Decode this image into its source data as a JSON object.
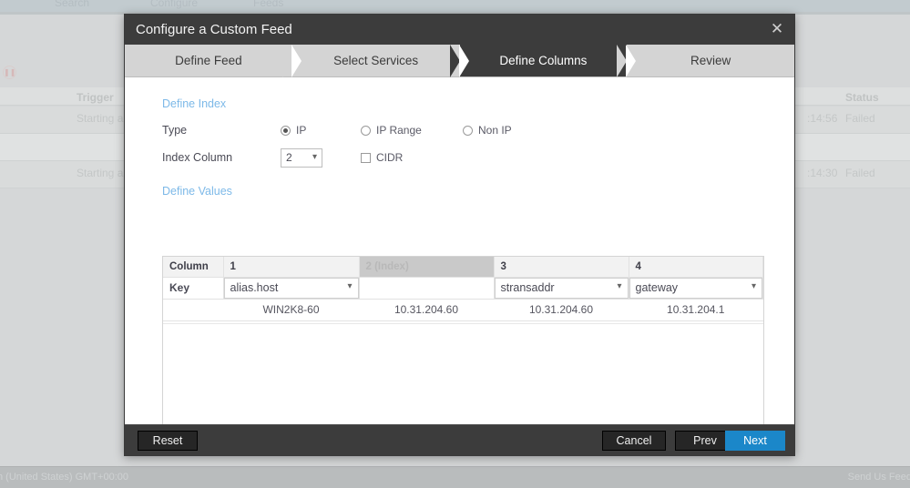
{
  "background": {
    "tabs": [
      "Search",
      "Configure",
      "Feeds"
    ],
    "pause_icon": "pause-icon",
    "columns": {
      "trigger": "Trigger",
      "status": "Status"
    },
    "rows": [
      {
        "trigger": "Starting a",
        "time": ":14:56",
        "status": "Failed"
      },
      {
        "trigger": "Starting a",
        "time": ":14:30",
        "status": "Failed"
      }
    ],
    "statusbar": {
      "left": "h (United States) GMT+00:00",
      "right": "Send Us Feed"
    }
  },
  "modal": {
    "title": "Configure a Custom Feed",
    "close_icon": "close-icon",
    "steps": [
      {
        "label": "Define Feed",
        "active": false
      },
      {
        "label": "Select Services",
        "active": false
      },
      {
        "label": "Define Columns",
        "active": true
      },
      {
        "label": "Review",
        "active": false
      }
    ],
    "define_index": {
      "title": "Define Index",
      "type_label": "Type",
      "type_options": [
        {
          "label": "IP",
          "selected": true
        },
        {
          "label": "IP Range",
          "selected": false
        },
        {
          "label": "Non IP",
          "selected": false
        }
      ],
      "index_column_label": "Index Column",
      "index_column_value": "2",
      "cidr_label": "CIDR",
      "cidr_checked": false
    },
    "define_values": {
      "title": "Define Values",
      "row_labels": {
        "column": "Column",
        "key": "Key"
      },
      "columns": [
        {
          "header": "1",
          "key": "alias.host",
          "is_index": false,
          "value": "WIN2K8-60"
        },
        {
          "header": "2 (Index)",
          "key": "",
          "is_index": true,
          "value": "10.31.204.60"
        },
        {
          "header": "3",
          "key": "stransaddr",
          "is_index": false,
          "value": "10.31.204.60"
        },
        {
          "header": "4",
          "key": "gateway",
          "is_index": false,
          "value": "10.31.204.1"
        }
      ],
      "scrollbar": {
        "left_arrow": "chevron-left-icon",
        "right_arrow": "chevron-right-icon"
      }
    },
    "footer": {
      "reset": "Reset",
      "cancel": "Cancel",
      "prev": "Prev",
      "next": "Next"
    }
  },
  "colors": {
    "accent": "#1b87c9",
    "titlebar": "#3c3c3c",
    "step_active": "#3c3c3c",
    "section_title": "#7db9e8",
    "index_header": "#c9c9c9"
  }
}
